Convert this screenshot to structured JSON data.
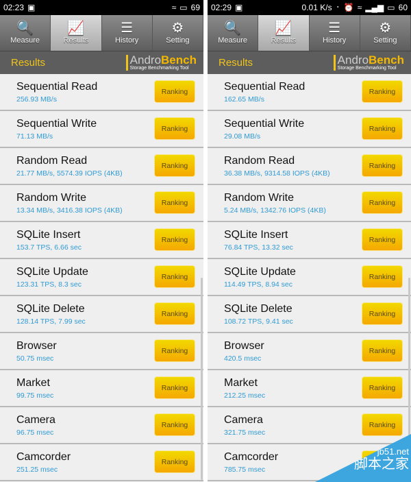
{
  "tabs": [
    {
      "label": "Measure",
      "icon": "search-icon"
    },
    {
      "label": "Results",
      "icon": "chart-icon"
    },
    {
      "label": "History",
      "icon": "list-icon"
    },
    {
      "label": "Setting",
      "icon": "gear-icon"
    }
  ],
  "header": {
    "title": "Results",
    "logo_a": "Andro",
    "logo_b": "Bench",
    "logo_sub": "Storage Benchmarking Tool"
  },
  "ranking_label": "Ranking",
  "colors": {
    "accent": "#f0c419",
    "value": "#2f9ad5",
    "button": "#f5c000"
  },
  "panels": [
    {
      "status": {
        "time": "02:23",
        "right": "69"
      },
      "rows": [
        {
          "name": "Sequential Read",
          "value": "256.93 MB/s"
        },
        {
          "name": "Sequential Write",
          "value": "71.13 MB/s"
        },
        {
          "name": "Random Read",
          "value": "21.77 MB/s, 5574.39 IOPS (4KB)"
        },
        {
          "name": "Random Write",
          "value": "13.34 MB/s, 3416.38 IOPS (4KB)"
        },
        {
          "name": "SQLite Insert",
          "value": "153.7 TPS, 6.66 sec"
        },
        {
          "name": "SQLite Update",
          "value": "123.31 TPS, 8.3 sec"
        },
        {
          "name": "SQLite Delete",
          "value": "128.14 TPS, 7.99 sec"
        },
        {
          "name": "Browser",
          "value": "50.75 msec"
        },
        {
          "name": "Market",
          "value": "99.75 msec"
        },
        {
          "name": "Camera",
          "value": "96.75 msec"
        },
        {
          "name": "Camcorder",
          "value": "251.25 msec"
        }
      ]
    },
    {
      "status": {
        "time": "02:29",
        "speed": "0.01 K/s",
        "right": "60"
      },
      "rows": [
        {
          "name": "Sequential Read",
          "value": "162.65 MB/s"
        },
        {
          "name": "Sequential Write",
          "value": "29.08 MB/s"
        },
        {
          "name": "Random Read",
          "value": "36.38 MB/s, 9314.58 IOPS (4KB)"
        },
        {
          "name": "Random Write",
          "value": "5.24 MB/s, 1342.76 IOPS (4KB)"
        },
        {
          "name": "SQLite Insert",
          "value": "76.84 TPS, 13.32 sec"
        },
        {
          "name": "SQLite Update",
          "value": "114.49 TPS, 8.94 sec"
        },
        {
          "name": "SQLite Delete",
          "value": "108.72 TPS, 9.41 sec"
        },
        {
          "name": "Browser",
          "value": "420.5 msec"
        },
        {
          "name": "Market",
          "value": "212.25 msec"
        },
        {
          "name": "Camera",
          "value": "321.75 msec"
        },
        {
          "name": "Camcorder",
          "value": "785.75 msec"
        }
      ]
    }
  ],
  "watermark": {
    "site": "jb51.net",
    "name": "脚本之家"
  }
}
